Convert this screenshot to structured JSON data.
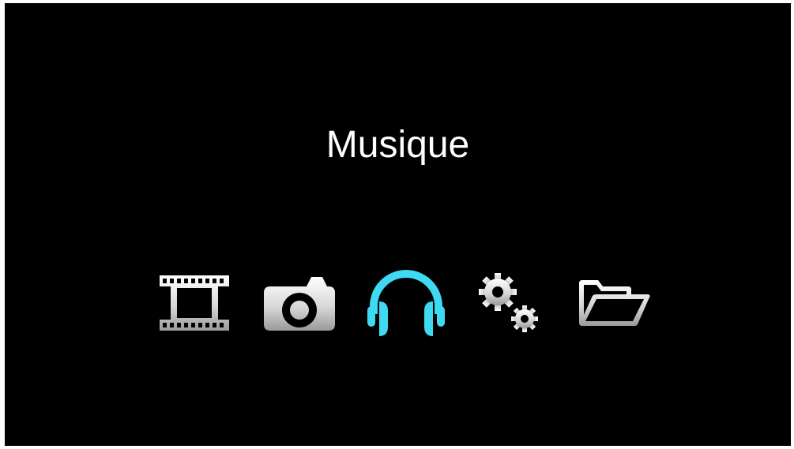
{
  "screen": {
    "title": "Musique"
  },
  "menu": {
    "selected_index": 2,
    "accent_color": "#3fd9f2",
    "items": [
      {
        "icon": "film-icon"
      },
      {
        "icon": "camera-icon"
      },
      {
        "icon": "headphones-icon"
      },
      {
        "icon": "gears-icon"
      },
      {
        "icon": "folder-icon"
      }
    ]
  }
}
